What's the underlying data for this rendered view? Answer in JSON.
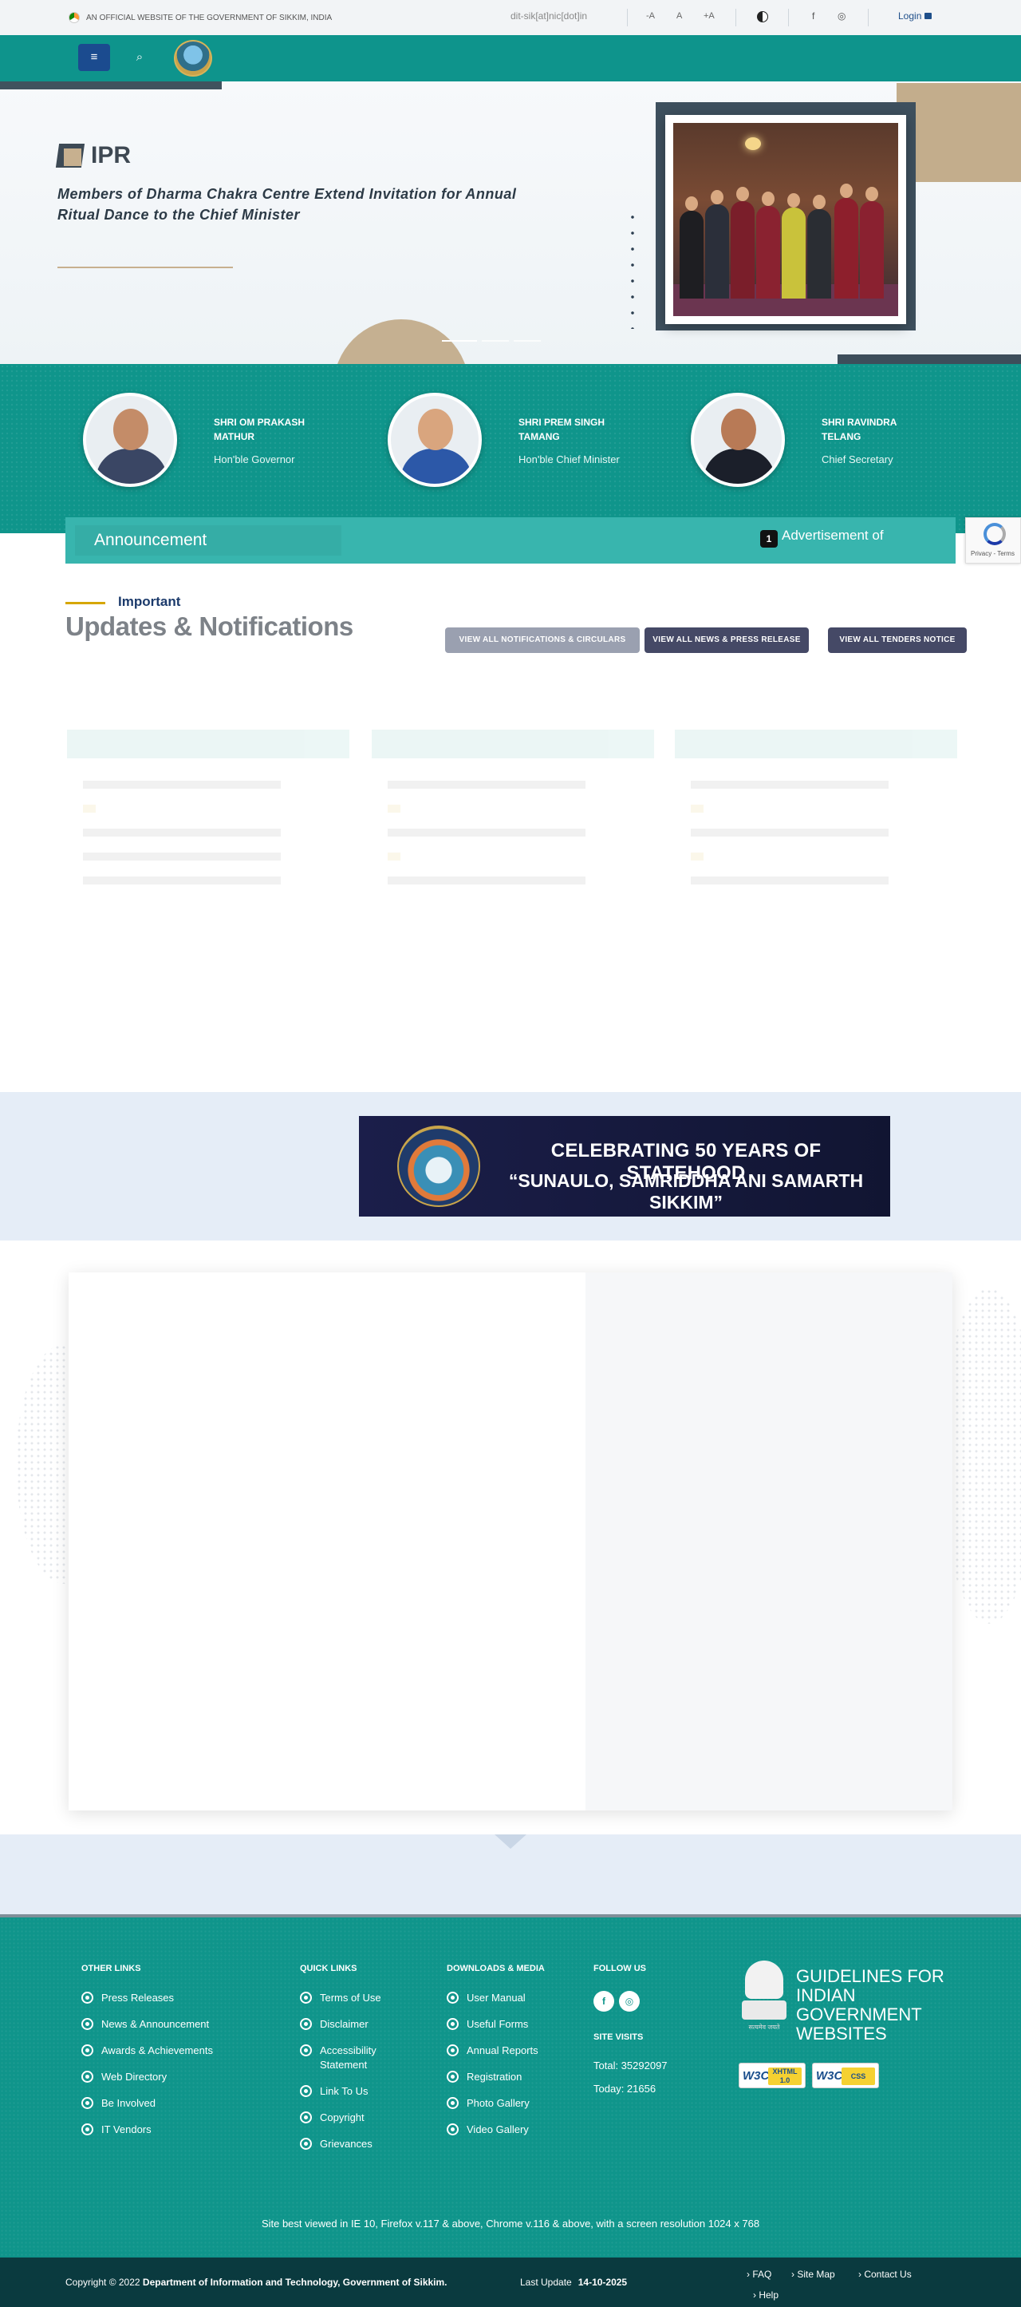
{
  "topbar": {
    "official": "AN OFFICIAL WEBSITE OF THE GOVERNMENT OF SIKKIM, INDIA",
    "email": "dit-sik[at]nic[dot]in",
    "font_minus": "-A",
    "font_normal": "A",
    "font_plus": "+A",
    "facebook": "f",
    "instagram": "◎",
    "login": "Login"
  },
  "nav": {
    "menu_icon": "≡",
    "search_icon": "⌕"
  },
  "hero": {
    "logo_text": "IPR",
    "headline": "Members of Dharma Chakra Centre Extend Invitation for Annual Ritual Dance to the Chief Minister"
  },
  "leaders": [
    {
      "name": "SHRI OM PRAKASH MATHUR",
      "role": "Hon'ble Governor"
    },
    {
      "name": "SHRI PREM SINGH TAMANG",
      "role": "Hon'ble Chief Minister"
    },
    {
      "name": "SHRI RAVINDRA TELANG",
      "role": "Chief Secretary"
    }
  ],
  "announcement": {
    "label": "Announcement",
    "count": "1",
    "ticker": "Advertisement of"
  },
  "recaptcha": {
    "text": "Privacy - Terms"
  },
  "updates": {
    "eyebrow": "Important",
    "title": "Updates & Notifications",
    "btn_notifications": "VIEW ALL NOTIFICATIONS & CIRCULARS",
    "btn_news": "VIEW ALL NEWS & PRESS RELEASE",
    "btn_tenders": "VIEW ALL TENDERS NOTICE"
  },
  "banner": {
    "line1": "CELEBRATING 50 YEARS OF STATEHOOD",
    "line2": "“SUNAULO, SAMRIDDHA ANI SAMARTH SIKKIM”"
  },
  "footer": {
    "other_links": {
      "title": "OTHER LINKS",
      "items": [
        "Press Releases",
        "News & Announcement",
        "Awards & Achievements",
        "Web Directory",
        "Be Involved",
        "IT Vendors"
      ]
    },
    "quick_links": {
      "title": "QUICK LINKS",
      "items": [
        "Terms of Use",
        "Disclaimer",
        "Accessibility Statement",
        "Link To Us",
        "Copyright",
        "Grievances"
      ]
    },
    "downloads": {
      "title": "DOWNLOADS & MEDIA",
      "items": [
        "User Manual",
        "Useful Forms",
        "Annual Reports",
        "Registration",
        "Photo Gallery",
        "Video Gallery"
      ]
    },
    "follow_title": "FOLLOW US",
    "site_visits_title": "SITE VISITS",
    "total": "Total: 35292097",
    "today": "Today: 21656",
    "gigw_text": "GUIDELINES FOR INDIAN GOVERNMENT WEBSITES",
    "gigw_caption": "सत्यमेव जयते",
    "w3c_xhtml": "XHTML 1.0",
    "w3c_css": "CSS",
    "w3c_mark": "W3C",
    "best_viewed": "Site best viewed in IE 10, Firefox v.117 & above, Chrome v.116 & above, with a screen resolution 1024 x 768"
  },
  "bottom": {
    "copyright_prefix": "Copyright © 2022 ",
    "copyright_org": "Department of Information and Technology, Government of Sikkim.",
    "last_update_label": "Last Update",
    "last_update": "14-10-2025",
    "links": [
      "FAQ",
      "Site Map",
      "Contact Us",
      "Help"
    ]
  },
  "colors": {
    "teal": "#0f958b",
    "navy": "#1b4b8f",
    "tan": "#c5b091",
    "slate": "#3e505e"
  }
}
